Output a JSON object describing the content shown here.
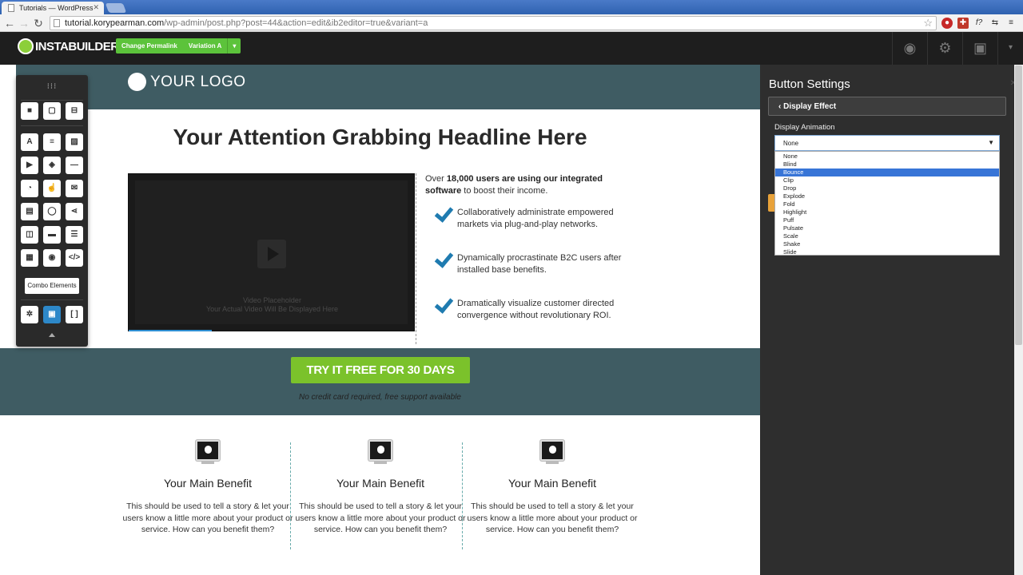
{
  "browser": {
    "tab_title": "Tutorials — WordPress",
    "url_host": "tutorial.korypearman.com",
    "url_path": "/wp-admin/post.php?post=44&action=edit&ib2editor=true&variant=a"
  },
  "builder": {
    "logo": "INSTABUILDER 2.0",
    "change_permalink": "Change Permalink",
    "variation": "Variation A"
  },
  "page": {
    "logo_text": "YOUR LOGO",
    "headline": "Your Attention Grabbing Headline Here",
    "video_caption_1": "Video Placeholder",
    "video_caption_2": "Your Actual Video Will Be Displayed Here",
    "intro_pre": "Over ",
    "intro_bold1": "18,000 users are using our integrated software",
    "intro_post": " to boost their income.",
    "bullets": [
      "Collaboratively administrate empowered markets via plug-and-play networks.",
      "Dynamically procrastinate B2C users after installed base benefits.",
      "Dramatically visualize customer directed convergence without revolutionary ROI."
    ],
    "cta_label": "TRY IT FREE FOR 30 DAYS",
    "cta_note": "No credit card required, free support available",
    "benefits": [
      {
        "title": "Your Main Benefit",
        "text": "This should be used to tell a story & let your users know a little more about your product or service. How can you benefit them?"
      },
      {
        "title": "Your Main Benefit",
        "text": "This should be used to tell a story & let your users know a little more about your product or service. How can you benefit them?"
      },
      {
        "title": "Your Main Benefit",
        "text": "This should be used to tell a story & let your users know a little more about your product or service. How can you benefit them?"
      }
    ]
  },
  "palette": {
    "combo_label": "Combo Elements"
  },
  "panel": {
    "title": "Button Settings",
    "back_label": "Display Effect",
    "field_label": "Display Animation",
    "selected_value": "None",
    "options": [
      "None",
      "Blind",
      "Bounce",
      "Clip",
      "Drop",
      "Explode",
      "Fold",
      "Highlight",
      "Puff",
      "Pulsate",
      "Scale",
      "Shake",
      "Slide"
    ],
    "highlighted_option": "Bounce"
  },
  "colors": {
    "band": "#3f5c63",
    "cta": "#7bc22b",
    "check": "#1f7bb0",
    "highlight": "#3875d7"
  }
}
